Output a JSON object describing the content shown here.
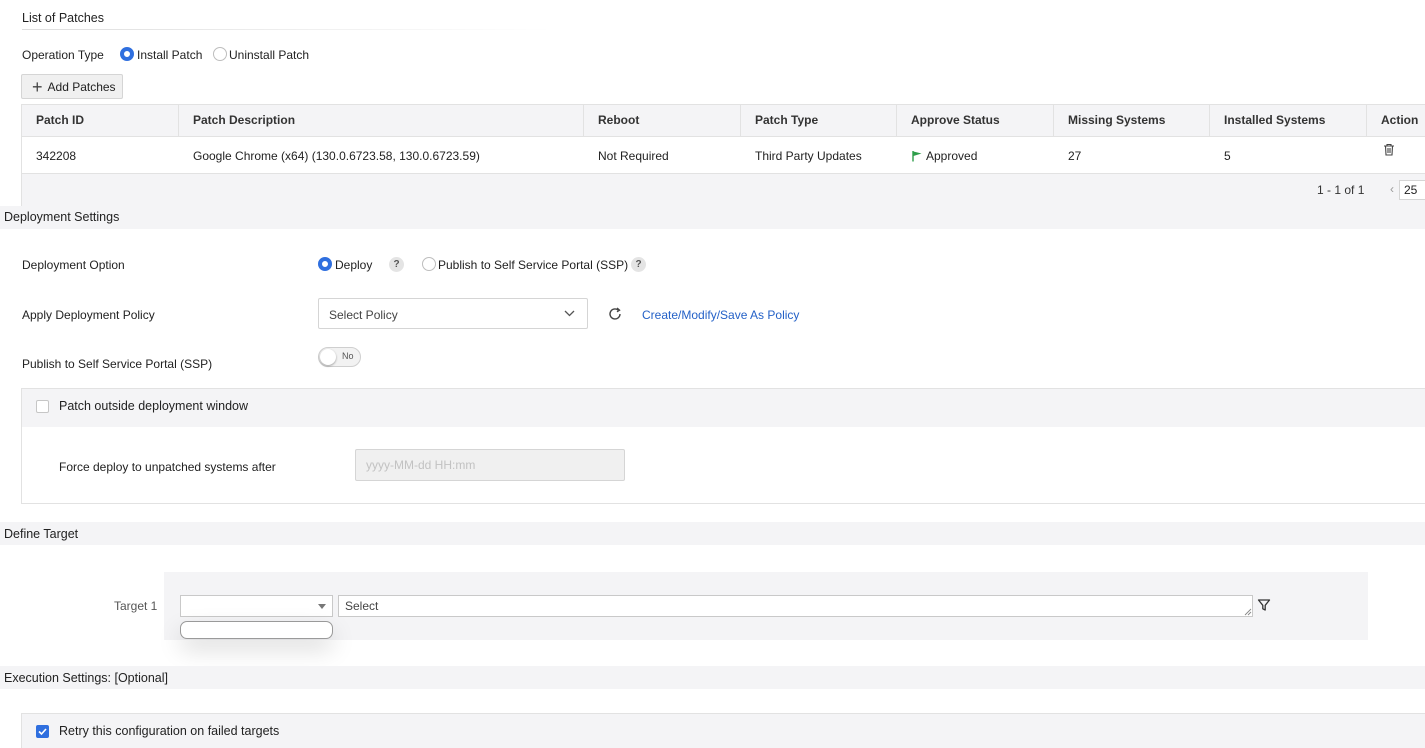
{
  "patches_section": {
    "title": "List of Patches",
    "operation_type_label": "Operation Type",
    "operation_options": [
      {
        "label": "Install Patch",
        "selected": true
      },
      {
        "label": "Uninstall Patch",
        "selected": false
      }
    ],
    "add_button_label": "Add Patches"
  },
  "patch_table": {
    "columns": [
      "Patch ID",
      "Patch Description",
      "Reboot",
      "Patch Type",
      "Approve Status",
      "Missing Systems",
      "Installed Systems",
      "Action"
    ],
    "rows": [
      {
        "patch_id": "342208",
        "description": "Google Chrome (x64) (130.0.6723.58, 130.0.6723.59)",
        "reboot": "Not Required",
        "patch_type": "Third Party Updates",
        "approve_status": "Approved",
        "missing_systems": "27",
        "installed_systems": "5",
        "action_icon": "trash-icon"
      }
    ],
    "pagination_text": "1 - 1 of 1",
    "page_size": "25"
  },
  "deployment": {
    "title": "Deployment Settings",
    "option_label": "Deployment Option",
    "options": [
      {
        "label": "Deploy",
        "selected": true
      },
      {
        "label": "Publish to Self Service Portal (SSP)",
        "selected": false
      }
    ],
    "help_glyph": "?",
    "policy_label": "Apply Deployment Policy",
    "policy_placeholder": "Select Policy",
    "policy_link": "Create/Modify/Save As Policy",
    "ssp_label": "Publish to Self Service Portal (SSP)",
    "ssp_toggle_text": "No",
    "outside_window_label": "Patch outside deployment window",
    "force_deploy_label": "Force deploy to unpatched systems after",
    "force_deploy_placeholder": "yyyy-MM-dd HH:mm"
  },
  "target": {
    "title": "Define Target",
    "target_label": "Target 1",
    "type_value": "",
    "select_placeholder": "Select"
  },
  "execution": {
    "title": "Execution Settings: [Optional]",
    "retry_label": "Retry this configuration on failed targets",
    "retry_checked": true
  },
  "colors": {
    "accent": "#2f6fdf",
    "link": "#2461c7",
    "approved_flag": "#2e9e4a",
    "band": "#f4f4f6"
  }
}
